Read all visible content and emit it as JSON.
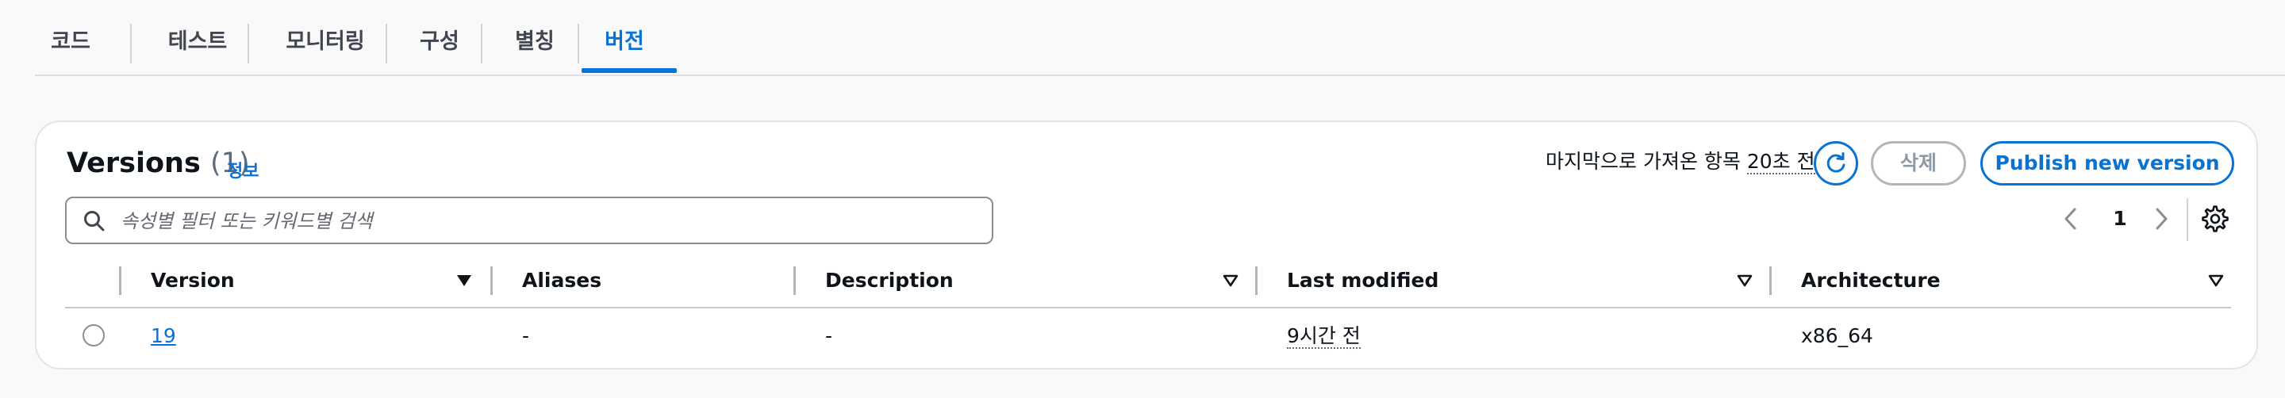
{
  "tabs": [
    {
      "label": "코드"
    },
    {
      "label": "테스트"
    },
    {
      "label": "모니터링"
    },
    {
      "label": "구성"
    },
    {
      "label": "별칭"
    },
    {
      "label": "버전",
      "active": true
    }
  ],
  "panel": {
    "title": "Versions",
    "count": "(1)",
    "info_link": "정보",
    "last_fetched_prefix": "마지막으로 가져온 항목",
    "last_fetched_time": "20초 전",
    "delete_label": "삭제",
    "publish_label": "Publish new version",
    "search_placeholder": "속성별 필터 또는 키워드별 검색",
    "page_number": "1"
  },
  "table": {
    "columns": [
      "Version",
      "Aliases",
      "Description",
      "Last modified",
      "Architecture"
    ],
    "rows": [
      {
        "version": "19",
        "aliases": "-",
        "description": "-",
        "last_modified": "9시간 전",
        "architecture": "x86_64"
      }
    ]
  },
  "colors": {
    "accent": "#0972d3",
    "text": "#0f141a",
    "muted_button": "#8d99a8",
    "border": "#e2e4e8"
  },
  "icons": [
    "search-icon",
    "refresh-icon",
    "chevron-left-icon",
    "chevron-right-icon",
    "settings-icon",
    "sort-desc-icon",
    "sort-icon"
  ]
}
